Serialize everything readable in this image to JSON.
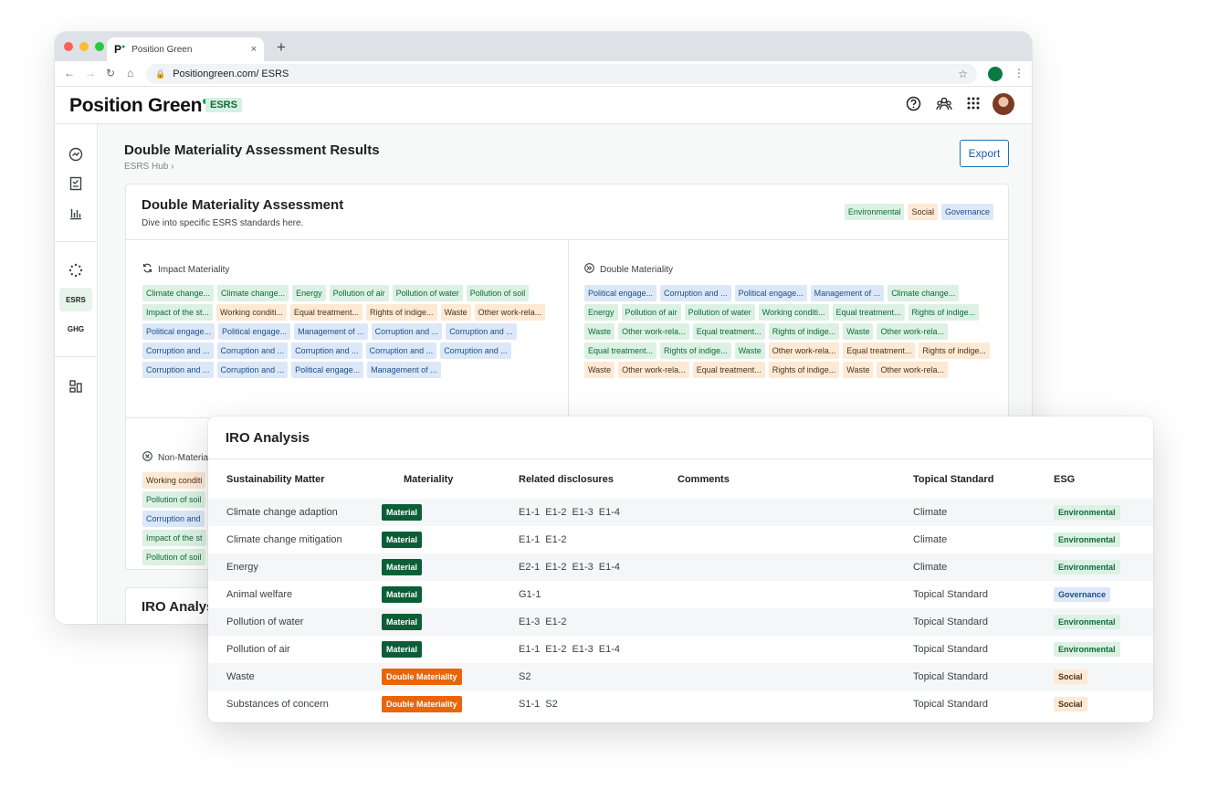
{
  "browser": {
    "tab_title": "Position Green",
    "tab_favicon": "P",
    "url": "Positiongreen.com/ ESRS",
    "new_tab_symbol": "+",
    "close_symbol": "×"
  },
  "app": {
    "logo": "Position Green",
    "module_badge": "ESRS",
    "rail": {
      "esrs_label": "ESRS",
      "ghg_label": "GHG"
    }
  },
  "page": {
    "title": "Double Materiality Assessment Results",
    "breadcrumb": "ESRS Hub  ›",
    "export_label": "Export"
  },
  "assessment": {
    "title": "Double Materiality Assessment",
    "subtitle": "Dive into specific ESRS standards here.",
    "legend": [
      {
        "label": "Environmental",
        "type": "env"
      },
      {
        "label": "Social",
        "type": "soc"
      },
      {
        "label": "Governance",
        "type": "gov"
      }
    ],
    "impact": {
      "heading": "Impact Materiality",
      "tags": [
        {
          "label": "Climate change...",
          "type": "env"
        },
        {
          "label": "Climate change...",
          "type": "env"
        },
        {
          "label": "Energy",
          "type": "env"
        },
        {
          "label": "Pollution of air",
          "type": "env"
        },
        {
          "label": "Pollution of water",
          "type": "env"
        },
        {
          "label": "Pollution of soil",
          "type": "env"
        },
        {
          "label": "Impact of the st...",
          "type": "env"
        },
        {
          "label": "Working conditi...",
          "type": "soc"
        },
        {
          "label": "Equal treatment...",
          "type": "soc"
        },
        {
          "label": "Rights of indige...",
          "type": "soc"
        },
        {
          "label": "Waste",
          "type": "soc"
        },
        {
          "label": "Other work-rela...",
          "type": "soc"
        },
        {
          "label": "Political engage...",
          "type": "gov"
        },
        {
          "label": "Political engage...",
          "type": "gov"
        },
        {
          "label": "Management of ...",
          "type": "gov"
        },
        {
          "label": "Corruption and ...",
          "type": "gov"
        },
        {
          "label": "Corruption and ...",
          "type": "gov"
        },
        {
          "label": "Corruption and ...",
          "type": "gov"
        },
        {
          "label": "Corruption and ...",
          "type": "gov"
        },
        {
          "label": "Corruption and ...",
          "type": "gov"
        },
        {
          "label": "Corruption and ...",
          "type": "gov"
        },
        {
          "label": "Corruption and ...",
          "type": "gov"
        },
        {
          "label": "Corruption and ...",
          "type": "gov"
        },
        {
          "label": "Corruption and ...",
          "type": "gov"
        },
        {
          "label": "Political engage...",
          "type": "gov"
        },
        {
          "label": "Management of ...",
          "type": "gov"
        }
      ]
    },
    "double": {
      "heading": "Double Materiality",
      "tags": [
        {
          "label": "Political engage...",
          "type": "gov"
        },
        {
          "label": "Corruption and ...",
          "type": "gov"
        },
        {
          "label": "Political engage...",
          "type": "gov"
        },
        {
          "label": "Management of ...",
          "type": "gov"
        },
        {
          "label": "Climate change...",
          "type": "env"
        },
        {
          "label": "Energy",
          "type": "env"
        },
        {
          "label": "Pollution of air",
          "type": "env"
        },
        {
          "label": "Pollution of water",
          "type": "env"
        },
        {
          "label": "Working conditi...",
          "type": "env"
        },
        {
          "label": "Equal treatment...",
          "type": "env"
        },
        {
          "label": "Rights of indige...",
          "type": "env"
        },
        {
          "label": "Waste",
          "type": "env"
        },
        {
          "label": "Other work-rela...",
          "type": "env"
        },
        {
          "label": "Equal treatment...",
          "type": "env"
        },
        {
          "label": "Rights of indige...",
          "type": "env"
        },
        {
          "label": "Waste",
          "type": "env"
        },
        {
          "label": "Other work-rela...",
          "type": "env"
        },
        {
          "label": "Equal treatment...",
          "type": "env"
        },
        {
          "label": "Rights of indige...",
          "type": "env"
        },
        {
          "label": "Waste",
          "type": "env"
        },
        {
          "label": "Other work-rela...",
          "type": "soc"
        },
        {
          "label": "Equal treatment...",
          "type": "soc"
        },
        {
          "label": "Rights of indige...",
          "type": "soc"
        },
        {
          "label": "Waste",
          "type": "soc"
        },
        {
          "label": "Other work-rela...",
          "type": "soc"
        },
        {
          "label": "Equal treatment...",
          "type": "soc"
        },
        {
          "label": "Rights of indige...",
          "type": "soc"
        },
        {
          "label": "Waste",
          "type": "soc"
        },
        {
          "label": "Other work-rela...",
          "type": "soc"
        }
      ]
    },
    "non_material": {
      "heading": "Non-Materia",
      "tags": [
        {
          "label": "Working conditi",
          "type": "soc"
        },
        {
          "label": "Pollution of soil",
          "type": "env"
        },
        {
          "label": "Corruption and",
          "type": "gov"
        },
        {
          "label": "Impact of the st",
          "type": "env"
        },
        {
          "label": "Pollution of soil",
          "type": "env"
        }
      ]
    }
  },
  "iro_peek_title": "IRO Analysi",
  "iro": {
    "title": "IRO Analysis",
    "columns": [
      "Sustainability Matter",
      "Materiality",
      "Related disclosures",
      "Comments",
      "Topical Standard",
      "ESG"
    ],
    "rows": [
      {
        "matter": "Climate change adaption",
        "materiality": "Material",
        "mat_type": "mat",
        "disclosures": [
          "E1-1",
          "E1-2",
          "E1-3",
          "E1-4"
        ],
        "comments": "",
        "standard": "Climate",
        "esg": "Environmental",
        "esg_type": "env"
      },
      {
        "matter": "Climate change mitigation",
        "materiality": "Material",
        "mat_type": "mat",
        "disclosures": [
          "E1-1",
          "E1-2"
        ],
        "comments": "",
        "standard": "Climate",
        "esg": "Environmental",
        "esg_type": "env"
      },
      {
        "matter": "Energy",
        "materiality": "Material",
        "mat_type": "mat",
        "disclosures": [
          "E2-1",
          "E1-2",
          "E1-3",
          "E1-4"
        ],
        "comments": "",
        "standard": "Climate",
        "esg": "Environmental",
        "esg_type": "env"
      },
      {
        "matter": "Animal welfare",
        "materiality": "Material",
        "mat_type": "mat",
        "disclosures": [
          "G1-1"
        ],
        "comments": "",
        "standard": "Topical Standard",
        "esg": "Governance",
        "esg_type": "gov"
      },
      {
        "matter": "Pollution of water",
        "materiality": "Material",
        "mat_type": "mat",
        "disclosures": [
          "E1-3",
          "E1-2"
        ],
        "comments": "",
        "standard": "Topical Standard",
        "esg": "Environmental",
        "esg_type": "env"
      },
      {
        "matter": "Pollution of air",
        "materiality": "Material",
        "mat_type": "mat",
        "disclosures": [
          "E1-1",
          "E1-2",
          "E1-3",
          "E1-4"
        ],
        "comments": "",
        "standard": "Topical Standard",
        "esg": "Environmental",
        "esg_type": "env"
      },
      {
        "matter": "Waste",
        "materiality": "Double Materiality",
        "mat_type": "dbl",
        "disclosures": [
          "S2"
        ],
        "comments": "",
        "standard": "Topical Standard",
        "esg": "Social",
        "esg_type": "soc"
      },
      {
        "matter": "Substances of concern",
        "materiality": "Double Materiality",
        "mat_type": "dbl",
        "disclosures": [
          "S1-1",
          "S2"
        ],
        "comments": "",
        "standard": "Topical Standard",
        "esg": "Social",
        "esg_type": "soc"
      }
    ]
  }
}
